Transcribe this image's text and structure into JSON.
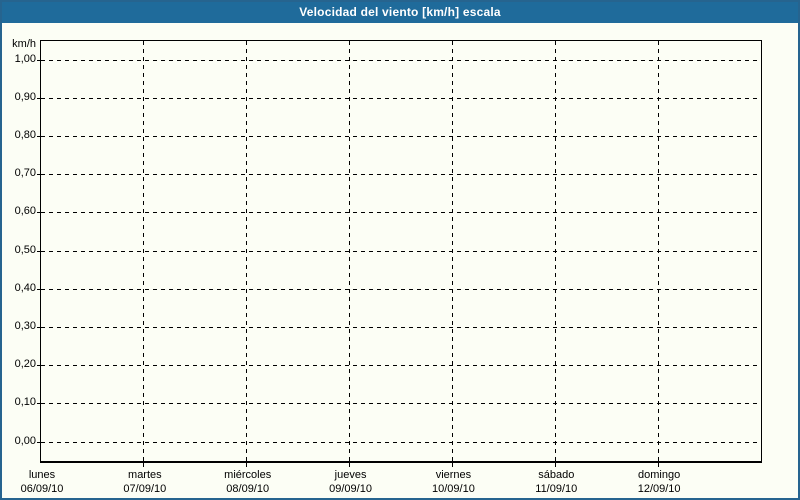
{
  "window": {
    "title": "Velocidad del viento [km/h] escala"
  },
  "colors": {
    "titlebar_bg": "#1f6b9b",
    "titlebar_text": "#ffffff",
    "window_border": "#26648f",
    "chart_bg": "#fcfef5",
    "grid_color": "#000000",
    "axis_text": "#000000"
  },
  "chart_data": {
    "type": "line",
    "title": "Velocidad del viento [km/h] escala",
    "ylabel": "km/h",
    "ylim": [
      0.0,
      1.0
    ],
    "y_tick_step": 0.1,
    "y_tick_labels": [
      "1,00",
      "0,90",
      "0,80",
      "0,70",
      "0,60",
      "0,50",
      "0,40",
      "0,30",
      "0,20",
      "0,10",
      "0,00"
    ],
    "x_categories": [
      {
        "day": "lunes",
        "date": "06/09/10"
      },
      {
        "day": "martes",
        "date": "07/09/10"
      },
      {
        "day": "miércoles",
        "date": "08/09/10"
      },
      {
        "day": "jueves",
        "date": "09/09/10"
      },
      {
        "day": "viernes",
        "date": "10/09/10"
      },
      {
        "day": "sábado",
        "date": "11/09/10"
      },
      {
        "day": "domingo",
        "date": "12/09/10"
      }
    ],
    "series": [],
    "grid": "dashed",
    "legend": "none"
  }
}
